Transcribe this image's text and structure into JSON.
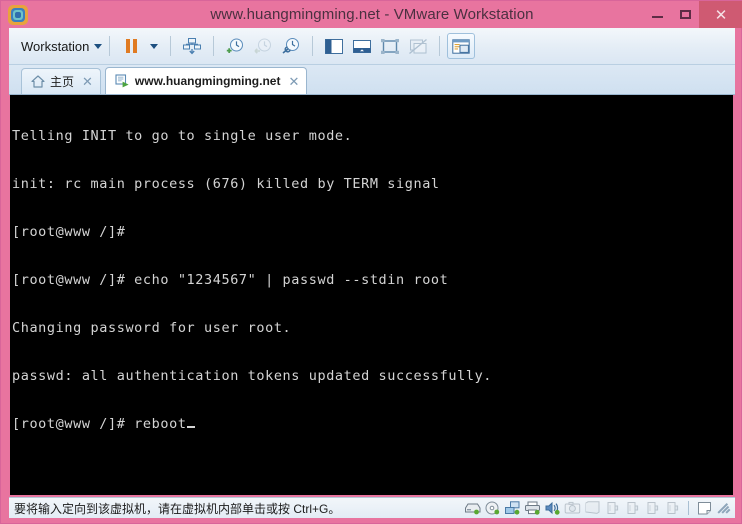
{
  "window": {
    "title": "www.huangmingming.net - VMware Workstation",
    "app_icon": "vmware-logo-icon",
    "controls": {
      "minimize": "minimize-icon",
      "maximize": "maximize-icon",
      "close": "✕"
    },
    "colors": {
      "titlebar_background": "#e8749f",
      "close_button": "#cf5a72",
      "toolbar_background": "#e4edf6",
      "console_background": "#000000",
      "terminal_text": "#d4d4d4"
    }
  },
  "toolbar": {
    "menu_label": "Workstation",
    "buttons": [
      {
        "name": "suspend-vm-button",
        "icon": "pause-icon",
        "title": "Suspend"
      },
      {
        "name": "power-dropdown-button",
        "icon": "chevron-down-icon",
        "title": "Power options"
      },
      {
        "name": "send-ctrl-alt-del-button",
        "icon": "send-key-icon",
        "title": "Send Ctrl+Alt+Delete"
      },
      {
        "name": "take-snapshot-button",
        "icon": "clock-plus-icon",
        "title": "Take snapshot"
      },
      {
        "name": "revert-snapshot-button",
        "icon": "clock-revert-icon",
        "title": "Revert to snapshot"
      },
      {
        "name": "snapshot-manager-button",
        "icon": "clock-wrench-icon",
        "title": "Manage snapshots"
      },
      {
        "name": "show-library-button",
        "icon": "sidebar-panel-icon",
        "title": "Show library"
      },
      {
        "name": "show-thumbnail-bar-button",
        "icon": "thumbnail-bar-icon",
        "title": "Show thumbnail bar"
      },
      {
        "name": "full-screen-button",
        "icon": "fullscreen-icon",
        "title": "Enter full screen"
      },
      {
        "name": "unity-mode-button",
        "icon": "unity-disabled-icon",
        "title": "Unity mode"
      },
      {
        "name": "preferences-button",
        "icon": "console-view-icon",
        "title": "Console view"
      }
    ]
  },
  "tabs": [
    {
      "label": "主页",
      "icon": "home-icon",
      "close": "✕",
      "active": false
    },
    {
      "label": "www.huangmingming.net",
      "icon": "virtual-machine-icon",
      "close": "✕",
      "active": true
    }
  ],
  "terminal": {
    "lines": [
      "Telling INIT to go to single user mode.",
      "init: rc main process (676) killed by TERM signal",
      "[root@www /]#",
      "[root@www /]# echo \"1234567\" | passwd --stdin root",
      "Changing password for user root.",
      "passwd: all authentication tokens updated successfully.",
      "[root@www /]# reboot"
    ],
    "cursor": "_"
  },
  "status_bar": {
    "message": "要将输入定向到该虚拟机，请在虚拟机内部单击或按 Ctrl+G。",
    "devices": [
      {
        "name": "hard-disk-icon",
        "label": "Hard Disk",
        "connected": true
      },
      {
        "name": "cd-dvd-icon",
        "label": "CD/DVD",
        "connected": true
      },
      {
        "name": "network-adapter-icon",
        "label": "Network Adapter",
        "connected": true
      },
      {
        "name": "printer-icon",
        "label": "Printer",
        "connected": true
      },
      {
        "name": "sound-card-icon",
        "label": "Sound Card",
        "connected": true
      },
      {
        "name": "camera-icon",
        "label": "Camera",
        "connected": false
      },
      {
        "name": "display-icon",
        "label": "Display",
        "connected": false
      },
      {
        "name": "usb-device-icon",
        "label": "USB Device 1",
        "connected": false
      },
      {
        "name": "usb-device-icon",
        "label": "USB Device 2",
        "connected": false
      },
      {
        "name": "usb-device-icon",
        "label": "USB Device 3",
        "connected": false
      },
      {
        "name": "usb-device-icon",
        "label": "USB Device 4",
        "connected": false
      }
    ],
    "notes_icon": "notes-icon",
    "resize_grip": "resize-grip-icon"
  }
}
